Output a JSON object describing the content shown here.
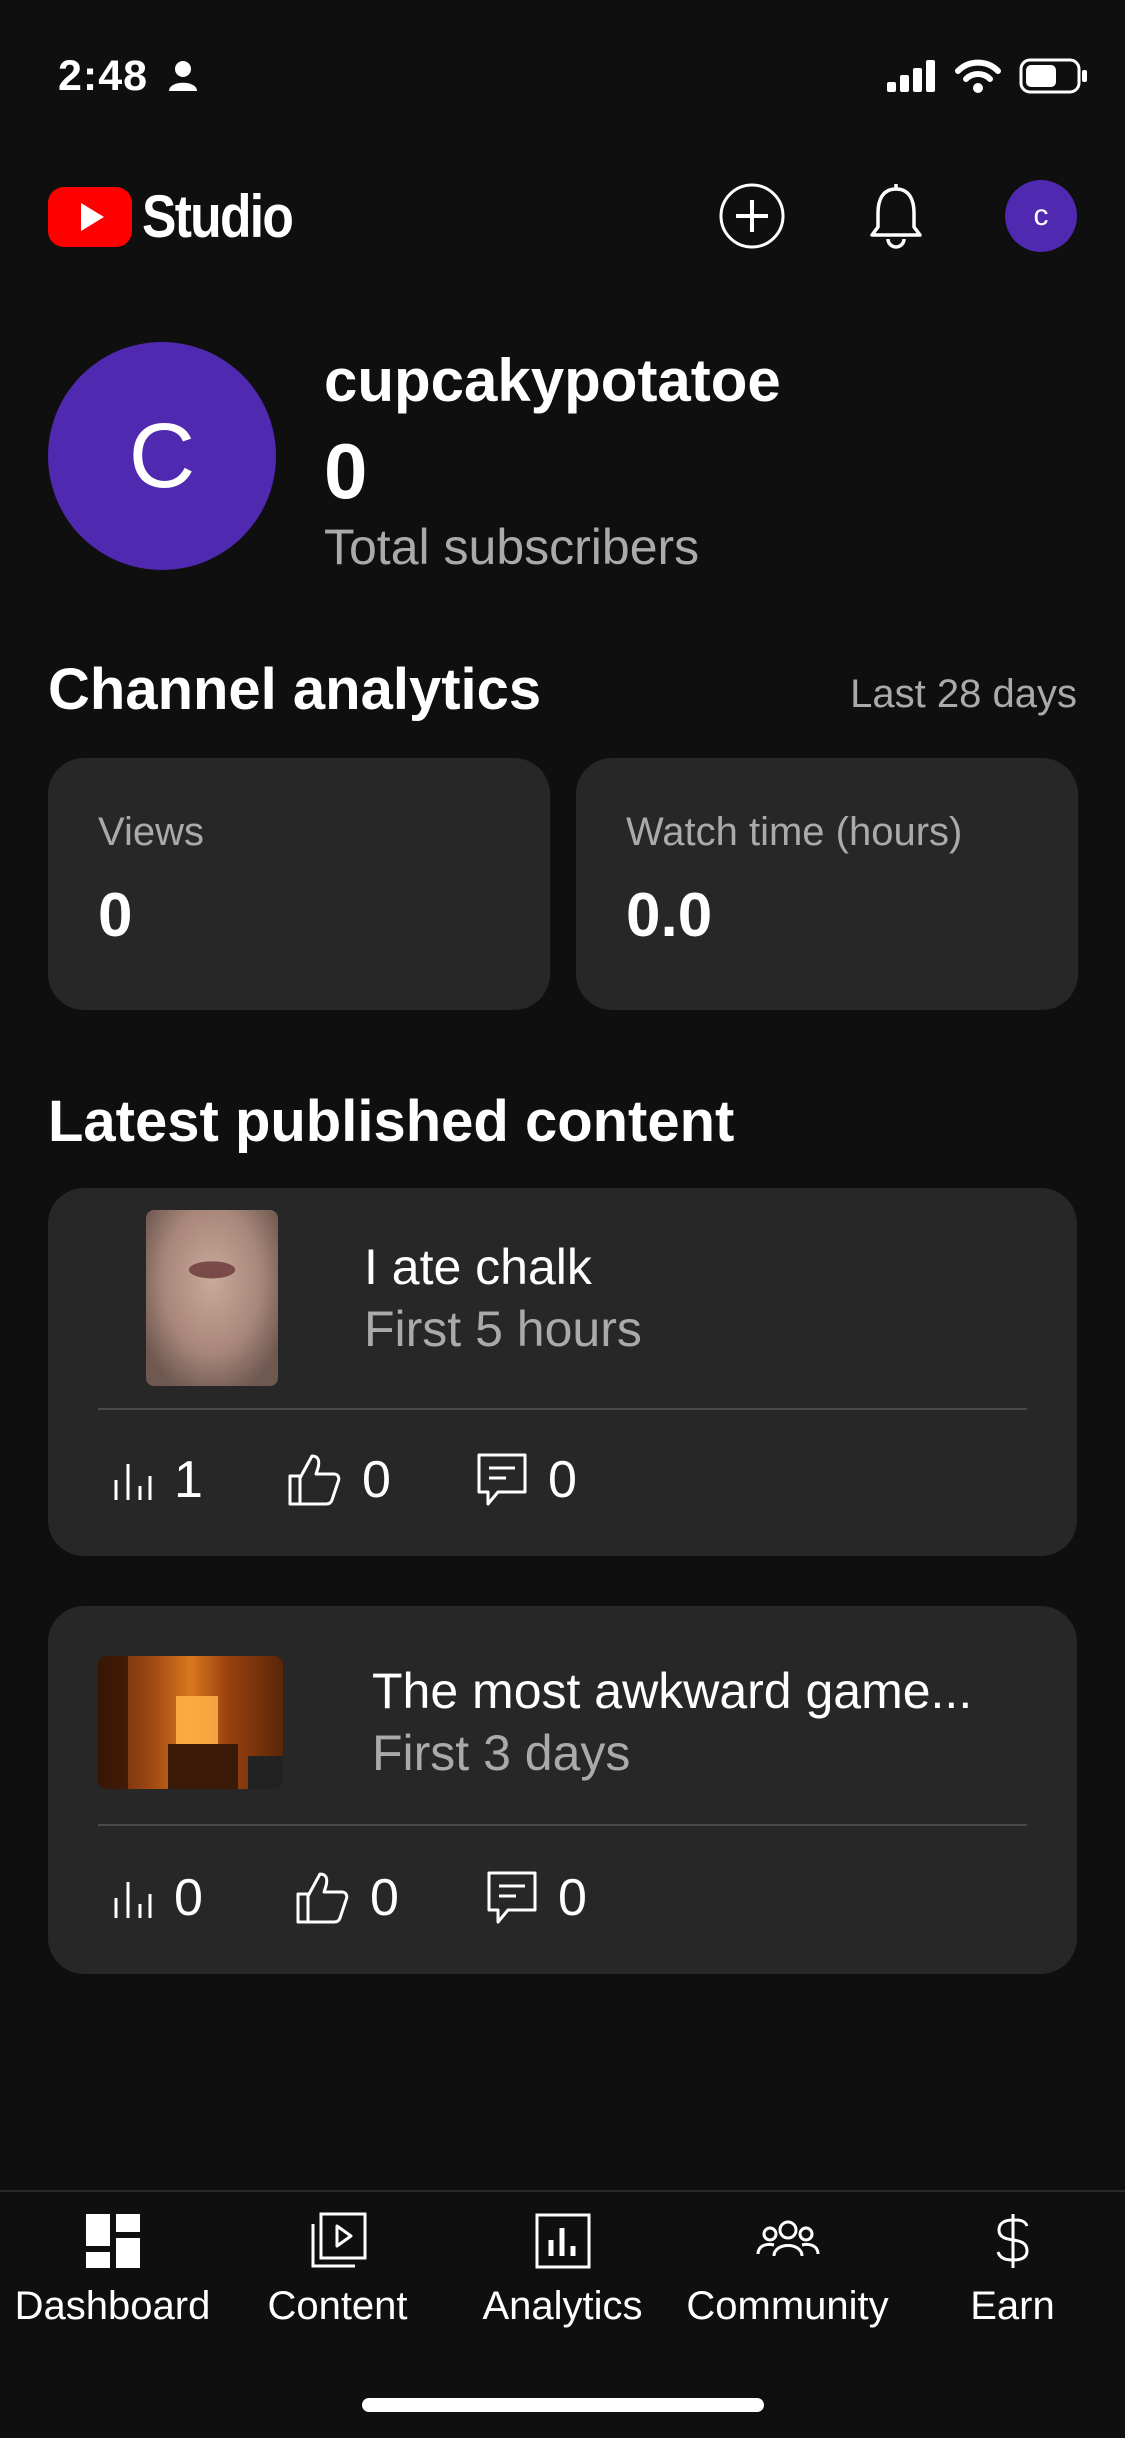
{
  "status_bar": {
    "time": "2:48"
  },
  "app": {
    "name": "Studio",
    "avatar_initial": "c"
  },
  "channel": {
    "initial": "C",
    "name": "cupcakypotatoe",
    "subscribers": "0",
    "subscribers_label": "Total subscribers"
  },
  "analytics": {
    "title": "Channel analytics",
    "range": "Last 28 days",
    "cards": [
      {
        "label": "Views",
        "value": "0"
      },
      {
        "label": "Watch time (hours)",
        "value": "0.0"
      }
    ]
  },
  "latest": {
    "title": "Latest published content",
    "items": [
      {
        "title": "I ate chalk",
        "period": "First 5 hours",
        "views": "1",
        "likes": "0",
        "comments": "0"
      },
      {
        "title": "The most awkward game...",
        "period": "First 3 days",
        "views": "0",
        "likes": "0",
        "comments": "0"
      }
    ]
  },
  "nav": {
    "items": [
      {
        "label": "Dashboard",
        "icon": "dashboard-icon"
      },
      {
        "label": "Content",
        "icon": "content-icon"
      },
      {
        "label": "Analytics",
        "icon": "analytics-icon"
      },
      {
        "label": "Community",
        "icon": "community-icon"
      },
      {
        "label": "Earn",
        "icon": "dollar-icon"
      }
    ]
  },
  "colors": {
    "background": "#0f0f0f",
    "card": "#272727",
    "avatar": "#4f2ab0",
    "youtube_red": "#ff0000",
    "secondary_text": "#aaaaaa"
  }
}
